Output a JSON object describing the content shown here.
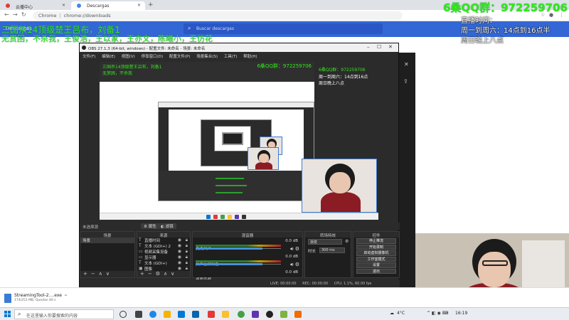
{
  "browser": {
    "tabs": [
      {
        "label": "云播中心"
      },
      {
        "label": "Descargas"
      }
    ],
    "url_scheme": "Chrome",
    "url_path": "chrome://downloads"
  },
  "downloads_page": {
    "title": "Descargas",
    "search_placeholder": "Buscar descargas"
  },
  "overlay": {
    "line1": "三国杀14顶级楚王吕布，刘备1",
    "line2": "无赏困，不杀我，王俊浩，王以家，王亦文，陈曦小，王仿花",
    "qq_group": "6桑QQ群：972259706",
    "schedule1": "直播时间：",
    "schedule2": "周一到周六：14点到16点半",
    "schedule3": "周日晚上八点"
  },
  "obs": {
    "title": "OBS 27.1.3 (64-bit, windows) - 配置文件: 未命名 - 场景: 未命名",
    "menu": [
      "文件(F)",
      "编辑(E)",
      "视图(V)",
      "停靠窗口(D)",
      "配置文件(P)",
      "场景集合(S)",
      "工具(T)",
      "帮助(H)"
    ],
    "no_source_label": "未选择源",
    "properties_btn": "属性",
    "filters_btn": "滤镜",
    "scenes_header": "场景",
    "scenes": [
      "场景"
    ],
    "sources_header": "来源",
    "sources": [
      "直播时间",
      "文本 (GDI+) 2",
      "视频采集设备",
      "显示器",
      "文本 (GDI+)",
      "图像"
    ],
    "mixer_header": "混音器",
    "mixer": [
      {
        "name": "麦克风/Aux",
        "db": "0.0 dB",
        "level": 0.78
      },
      {
        "name": "桌面音频设备",
        "db": "0.0 dB",
        "level": 0.78
      },
      {
        "name": "桌面音频",
        "db": "0.0 dB",
        "level": 0.78
      }
    ],
    "transitions_header": "转场特效",
    "transition_value": "渐变",
    "duration_label": "时长",
    "duration_value": "300 ms",
    "controls_header": "控件",
    "controls": [
      "停止推流",
      "开始录制",
      "启动虚拟摄像机",
      "工作室模式",
      "设置",
      "退出"
    ],
    "status": {
      "live": "LIVE: 00:00:00",
      "rec": "REC: 00:00:00",
      "cpu": "CPU: 1.1%, 60.00 fps"
    }
  },
  "nested_preview": {
    "top_line1": "三国杀14顶级楚王吕布，刘备1",
    "top_line2": "无赏困，不杀我",
    "qq_group": "6桑QQ群：972259706",
    "side1": "周一到周六：14点到16点",
    "side2": "周日晚上八点"
  },
  "download_shelf": {
    "file_name": "StreamingTool-2....exe",
    "file_status": "174/251 MB, Quedan 40 s"
  },
  "taskbar": {
    "search_placeholder": "在这里输入你要搜索的内容",
    "weather": "4°C",
    "time": "16:19"
  },
  "colors": {
    "overlay_green": "#34e81c",
    "chrome_blue": "#3367d6",
    "obs_dark": "#2b2b2b"
  }
}
